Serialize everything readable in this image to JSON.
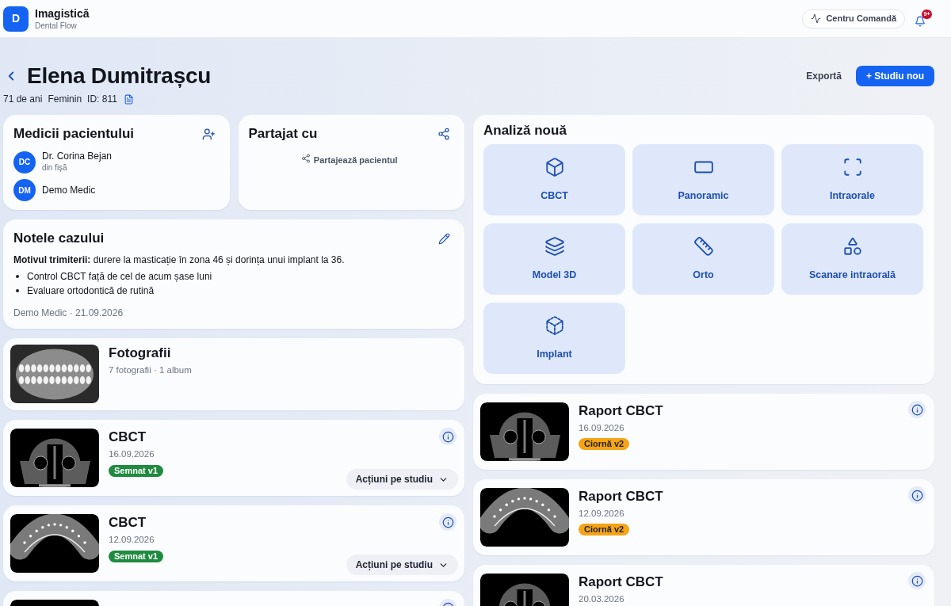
{
  "app": {
    "logo": "D",
    "name": "Imagistică",
    "subtitle": "Dental Flow"
  },
  "topbar": {
    "command_center": "Centru Comandă",
    "notification_count": "9+"
  },
  "patient": {
    "name": "Elena Dumitrașcu",
    "details": [
      "71 de ani",
      "Feminin",
      "ID: 811"
    ]
  },
  "page_actions": {
    "export": "Exportă",
    "new_study": "+ Studiu nou"
  },
  "doctors_card": {
    "title": "Medicii pacientului",
    "doctors": [
      {
        "initials": "DC",
        "name": "Dr. Corina Bejan",
        "note": "din fișă"
      },
      {
        "initials": "DM",
        "name": "Demo Medic"
      }
    ]
  },
  "shared_card": {
    "title": "Partajat cu",
    "share_action": "Partajează pacientul"
  },
  "notes_card": {
    "title": "Notele cazului",
    "reason": "**Motivul trimiterii:** durere la masticație în zona 46 și dorința unui implant la 36.",
    "items": [
      "Control CBCT față de cel de acum șase luni",
      "Evaluare ortodontică de rutină"
    ],
    "footer": "Demo Medic · 21.09.2026"
  },
  "studies": [
    {
      "kind": "photos",
      "preview": {
        "kind": "teeth"
      },
      "title": "Fotografii",
      "subtitle": "7 fotografii · 1 album"
    },
    {
      "kind": "study",
      "preview": {
        "kind": "head"
      },
      "title": "CBCT",
      "date": "16.09.2026",
      "badge": {
        "label": "Semnat v1",
        "kind": "signed"
      },
      "actions": "Acțiuni pe studiu"
    },
    {
      "kind": "study",
      "preview": {
        "kind": "arch"
      },
      "title": "CBCT",
      "date": "12.09.2026",
      "badge": {
        "label": "Semnat v1",
        "kind": "signed"
      },
      "actions": "Acțiuni pe studiu"
    },
    {
      "kind": "study",
      "preview": {
        "kind": "head"
      }
    }
  ],
  "new_analysis": {
    "title": "Analiză nouă",
    "options": [
      {
        "kind": "cbct",
        "label": "CBCT"
      },
      {
        "kind": "panoramic",
        "label": "Panoramic"
      },
      {
        "kind": "intraoral",
        "label": "Intraorale"
      },
      {
        "kind": "model3d",
        "label": "Model 3D"
      },
      {
        "kind": "ortho",
        "label": "Orto"
      },
      {
        "kind": "scan",
        "label": "Scanare intraorală"
      },
      {
        "kind": "implant",
        "label": "Implant"
      }
    ]
  },
  "reports": [
    {
      "preview": {
        "kind": "head"
      },
      "title": "Raport CBCT",
      "date": "16.09.2026",
      "badge": {
        "label": "Ciornă v2",
        "kind": "draft"
      }
    },
    {
      "preview": {
        "kind": "arch"
      },
      "title": "Raport CBCT",
      "date": "12.09.2026",
      "badge": {
        "label": "Ciornă v2",
        "kind": "draft"
      }
    },
    {
      "preview": {
        "kind": "head"
      },
      "title": "Raport CBCT",
      "date": "20.03.2026"
    }
  ]
}
